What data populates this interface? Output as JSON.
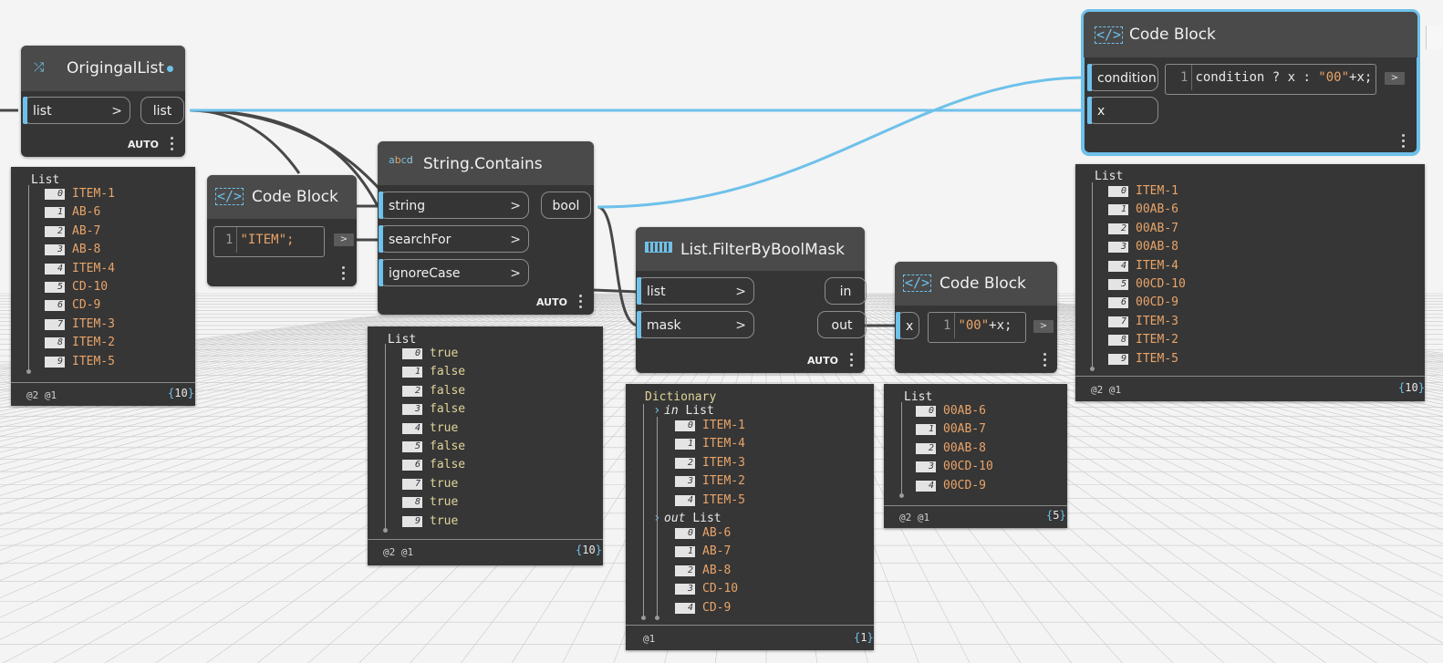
{
  "colors": {
    "wire_active": "#6ec1ea",
    "wire": "#474747",
    "node_bg": "#353535",
    "header_bg": "#4a4a4a",
    "string_value": "#e9a469",
    "bool_value": "#e0d49a",
    "accent": "#6ec1ea"
  },
  "nodes": {
    "originalList": {
      "title": "OrigingalList",
      "icon": "shuffle-icon",
      "input": "list",
      "output": "list",
      "lacing": "AUTO"
    },
    "codeBlockItem": {
      "title": "Code Block",
      "icon": "code-block-icon",
      "line": "1",
      "code": "\"ITEM\";"
    },
    "stringContains": {
      "title": "String.Contains",
      "icon": "abcd-icon",
      "inputs": [
        "string",
        "searchFor",
        "ignoreCase"
      ],
      "output": "bool",
      "lacing": "AUTO"
    },
    "filterByBoolMask": {
      "title": "List.FilterByBoolMask",
      "icon": "list-icon",
      "inputs": [
        "list",
        "mask"
      ],
      "outputs": [
        "in",
        "out"
      ],
      "lacing": "AUTO"
    },
    "codeBlockPrefix": {
      "title": "Code Block",
      "icon": "code-block-icon",
      "input": "x",
      "line": "1",
      "code_str": "\"00\"",
      "code_rest": "+x;"
    },
    "codeBlockCondition": {
      "title": "Code Block",
      "icon": "code-block-icon",
      "inputs": [
        "condition",
        "x"
      ],
      "line": "1",
      "code_a": "condition ? x : ",
      "code_str": "\"00\"",
      "code_b": "+x;"
    }
  },
  "previews": {
    "originalList": {
      "title": "List",
      "items": [
        "ITEM-1",
        "AB-6",
        "AB-7",
        "AB-8",
        "ITEM-4",
        "CD-10",
        "CD-9",
        "ITEM-3",
        "ITEM-2",
        "ITEM-5"
      ],
      "levels": "@2 @1",
      "count": "10"
    },
    "stringContains": {
      "title": "List",
      "items": [
        "true",
        "false",
        "false",
        "false",
        "true",
        "false",
        "false",
        "true",
        "true",
        "true"
      ],
      "levels": "@2 @1",
      "count": "10"
    },
    "filter": {
      "title": "Dictionary",
      "in_key": "in",
      "in_label": "List",
      "in_items": [
        "ITEM-1",
        "ITEM-4",
        "ITEM-3",
        "ITEM-2",
        "ITEM-5"
      ],
      "out_key": "out",
      "out_label": "List",
      "out_items": [
        "AB-6",
        "AB-7",
        "AB-8",
        "CD-10",
        "CD-9"
      ],
      "levels": "@1",
      "count": "1"
    },
    "prefix": {
      "title": "List",
      "items": [
        "00AB-6",
        "00AB-7",
        "00AB-8",
        "00CD-10",
        "00CD-9"
      ],
      "levels": "@2 @1",
      "count": "5"
    },
    "condition": {
      "title": "List",
      "items": [
        "ITEM-1",
        "00AB-6",
        "00AB-7",
        "00AB-8",
        "ITEM-4",
        "00CD-10",
        "00CD-9",
        "ITEM-3",
        "ITEM-2",
        "ITEM-5"
      ],
      "levels": "@2 @1",
      "count": "10"
    }
  },
  "indices": [
    "0",
    "1",
    "2",
    "3",
    "4",
    "5",
    "6",
    "7",
    "8",
    "9"
  ],
  "run_button": ">",
  "port_arrow": ">"
}
